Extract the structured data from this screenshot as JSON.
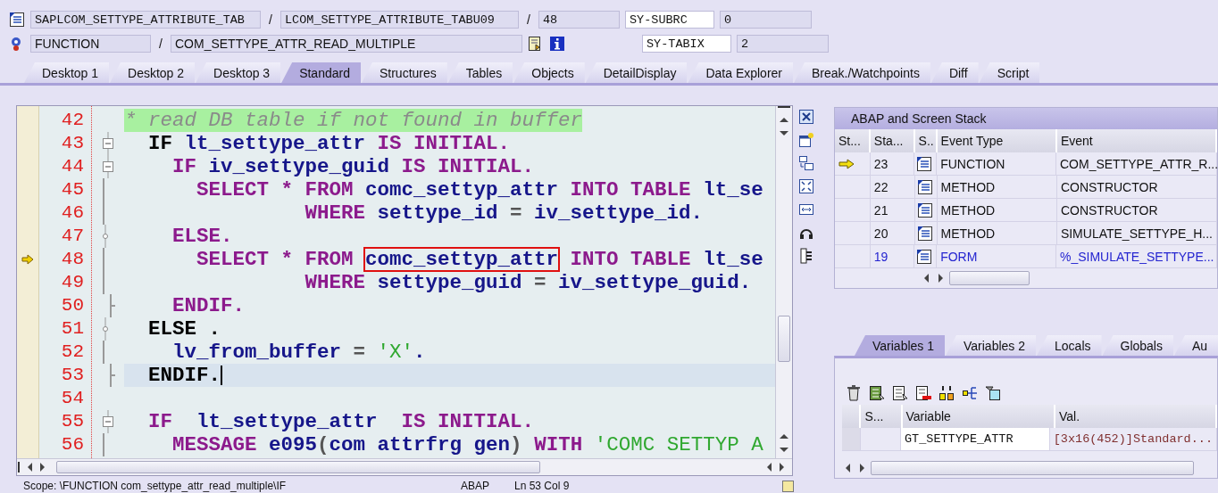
{
  "header": {
    "row_1": {
      "program": "SAPLCOM_SETTYPE_ATTRIBUTE_TAB",
      "include": "LCOM_SETTYPE_ATTRIBUTE_TABU09",
      "separators": [
        "/",
        "/"
      ],
      "line": "48",
      "field_name": "SY-SUBRC",
      "field_value": "0"
    },
    "row_2": {
      "event_type": "FUNCTION",
      "separator": "/",
      "event": "COM_SETTYPE_ATTR_READ_MULTIPLE",
      "field_name": "SY-TABIX",
      "field_value": "2"
    }
  },
  "tabs": [
    {
      "label": "Desktop 1",
      "selected": false
    },
    {
      "label": "Desktop 2",
      "selected": false
    },
    {
      "label": "Desktop 3",
      "selected": false
    },
    {
      "label": "Standard",
      "selected": true
    },
    {
      "label": "Structures",
      "selected": false
    },
    {
      "label": "Tables",
      "selected": false
    },
    {
      "label": "Objects",
      "selected": false
    },
    {
      "label": "DetailDisplay",
      "selected": false
    },
    {
      "label": "Data Explorer",
      "selected": false
    },
    {
      "label": "Break./Watchpoints",
      "selected": false
    },
    {
      "label": "Diff",
      "selected": false
    },
    {
      "label": "Script",
      "selected": false
    }
  ],
  "editor": {
    "lines": [
      {
        "number": "42",
        "kind": "plain",
        "current": false,
        "cursor": false,
        "tokens": [
          {
            "kind": "comment",
            "text": "* read DB table if not found in buffer"
          }
        ]
      },
      {
        "number": "43",
        "kind": "open",
        "current": false,
        "cursor": false,
        "tokens": [
          {
            "kind": "ctl",
            "text": "  IF"
          },
          {
            "kind": "id",
            "text": " lt_settype_attr "
          },
          {
            "kind": "kw",
            "text": "IS INITIAL."
          }
        ]
      },
      {
        "number": "44",
        "kind": "open",
        "current": false,
        "cursor": false,
        "tokens": [
          {
            "kind": "kw",
            "text": "    IF"
          },
          {
            "kind": "id",
            "text": " iv_settype_guid "
          },
          {
            "kind": "kw",
            "text": "IS INITIAL."
          }
        ]
      },
      {
        "number": "45",
        "kind": "inner",
        "current": false,
        "cursor": false,
        "tokens": [
          {
            "kind": "kw",
            "text": "      SELECT * FROM"
          },
          {
            "kind": "id",
            "text": " comc_settyp_attr "
          },
          {
            "kind": "kw",
            "text": "INTO TABLE"
          },
          {
            "kind": "id",
            "text": " lt_se"
          }
        ]
      },
      {
        "number": "46",
        "kind": "inner",
        "current": false,
        "cursor": false,
        "tokens": [
          {
            "kind": "kw",
            "text": "               WHERE"
          },
          {
            "kind": "id",
            "text": " settype_id "
          },
          {
            "kind": "op",
            "text": "="
          },
          {
            "kind": "id",
            "text": " iv_settype_id."
          }
        ]
      },
      {
        "number": "47",
        "kind": "branch",
        "current": false,
        "cursor": false,
        "tokens": [
          {
            "kind": "kw",
            "text": "    ELSE."
          }
        ]
      },
      {
        "number": "48",
        "kind": "inner",
        "current": true,
        "cursor": false,
        "tokens": [
          {
            "kind": "kw",
            "text": "      SELECT * FROM "
          },
          {
            "kind": "id",
            "text": "comc_settyp_attr",
            "marked": true
          },
          {
            "kind": "kw",
            "text": " INTO TABLE"
          },
          {
            "kind": "id",
            "text": " lt_se"
          }
        ]
      },
      {
        "number": "49",
        "kind": "inner",
        "current": false,
        "cursor": false,
        "tokens": [
          {
            "kind": "kw",
            "text": "               WHERE"
          },
          {
            "kind": "id",
            "text": " settype_guid "
          },
          {
            "kind": "op",
            "text": "="
          },
          {
            "kind": "id",
            "text": " iv_settype_guid."
          }
        ]
      },
      {
        "number": "50",
        "kind": "end",
        "current": false,
        "cursor": false,
        "tokens": [
          {
            "kind": "kw",
            "text": "    ENDIF."
          }
        ]
      },
      {
        "number": "51",
        "kind": "branch",
        "current": false,
        "cursor": false,
        "tokens": [
          {
            "kind": "ctl",
            "text": "  ELSE ."
          }
        ]
      },
      {
        "number": "52",
        "kind": "inner",
        "current": false,
        "cursor": false,
        "tokens": [
          {
            "kind": "id",
            "text": "    lv_from_buffer "
          },
          {
            "kind": "op",
            "text": "= "
          },
          {
            "kind": "str",
            "text": "'X'"
          },
          {
            "kind": "id",
            "text": "."
          }
        ]
      },
      {
        "number": "53",
        "kind": "end",
        "current": false,
        "cursor": true,
        "tokens": [
          {
            "kind": "ctl",
            "text": "  ENDIF."
          }
        ]
      },
      {
        "number": "54",
        "kind": "plain",
        "current": false,
        "cursor": false
      },
      {
        "number": "55",
        "kind": "open",
        "current": false,
        "cursor": false,
        "tokens": [
          {
            "kind": "kw",
            "text": "  IF"
          },
          {
            "kind": "id",
            "text": "  lt_settype_attr  "
          },
          {
            "kind": "kw",
            "text": "IS INITIAL."
          }
        ]
      },
      {
        "number": "56",
        "kind": "inner",
        "current": false,
        "cursor": false,
        "tokens": [
          {
            "kind": "kw",
            "text": "    MESSAGE"
          },
          {
            "kind": "id",
            "text": " e095"
          },
          {
            "kind": "op",
            "text": "("
          },
          {
            "kind": "id",
            "text": "com attrfrg gen"
          },
          {
            "kind": "op",
            "text": ")"
          },
          {
            "kind": "kw",
            "text": " WITH"
          },
          {
            "kind": "str",
            "text": " 'COMC SETTYP A"
          }
        ]
      }
    ]
  },
  "stack": {
    "title": "ABAP and Screen Stack",
    "columns": [
      "St...",
      "Sta...",
      "S..",
      "Event Type",
      "Event"
    ],
    "rows": [
      {
        "active": true,
        "highlighted": false,
        "number": "23",
        "event_type": "FUNCTION",
        "event": "COM_SETTYPE_ATTR_R..."
      },
      {
        "active": false,
        "highlighted": false,
        "number": "22",
        "event_type": "METHOD",
        "event": "CONSTRUCTOR"
      },
      {
        "active": false,
        "highlighted": false,
        "number": "21",
        "event_type": "METHOD",
        "event": "CONSTRUCTOR"
      },
      {
        "active": false,
        "highlighted": false,
        "number": "20",
        "event_type": "METHOD",
        "event": "SIMULATE_SETTYPE_H..."
      },
      {
        "active": false,
        "highlighted": true,
        "number": "19",
        "event_type": "FORM",
        "event": "%_SIMULATE_SETTYPE..."
      }
    ]
  },
  "variables": {
    "tabs": [
      {
        "label": "Variables 1",
        "selected": true
      },
      {
        "label": "Variables 2",
        "selected": false
      },
      {
        "label": "Locals",
        "selected": false
      },
      {
        "label": "Globals",
        "selected": false
      },
      {
        "label": "Au",
        "selected": false
      }
    ],
    "columns": [
      "S...",
      "Variable",
      "Val."
    ],
    "rows": [
      {
        "variable": "GT_SETTYPE_ATTR",
        "value": "[3x16(452)]Standard..."
      }
    ]
  },
  "status_bar": {
    "scope": "Scope: \\FUNCTION com_settype_attr_read_multiple\\IF",
    "language": "ABAP",
    "position": "Ln  53 Col  9"
  }
}
